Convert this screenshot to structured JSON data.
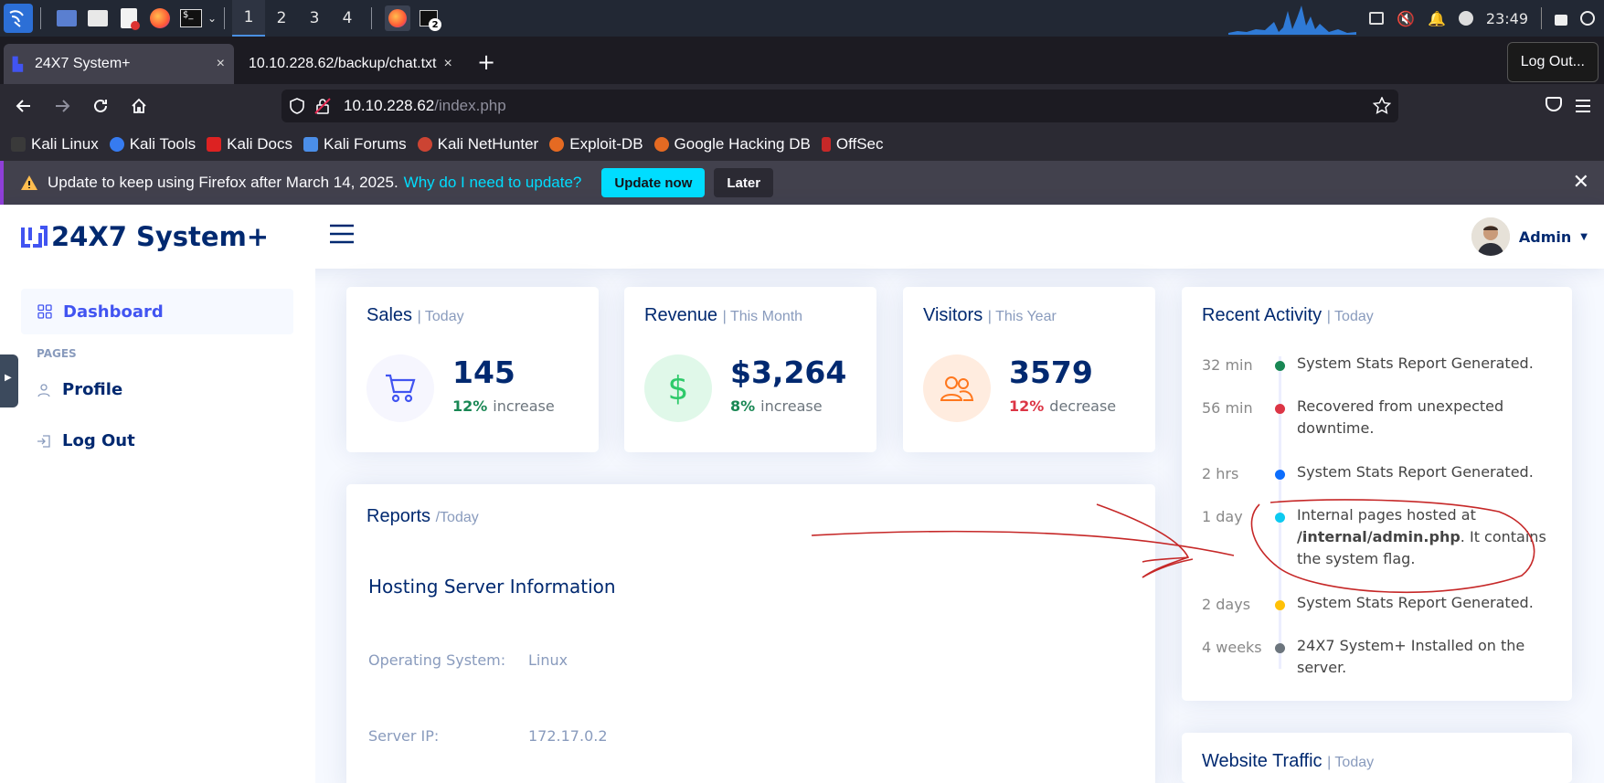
{
  "taskbar": {
    "workspaces": [
      "1",
      "2",
      "3",
      "4"
    ],
    "active_workspace": "1",
    "clock": "23:49",
    "terminal_badge": "2"
  },
  "browser": {
    "tabs": [
      {
        "title": "24X7 System+",
        "close": "×"
      },
      {
        "title": "10.10.228.62/backup/chat.txt",
        "close": "×"
      }
    ],
    "new_tab": "+",
    "tooltip": "Log Out...",
    "url_host": "10.10.228.62",
    "url_path": "/index.php",
    "bookmarks": [
      "Kali Linux",
      "Kali Tools",
      "Kali Docs",
      "Kali Forums",
      "Kali NetHunter",
      "Exploit-DB",
      "Google Hacking DB",
      "OffSec"
    ],
    "notification": {
      "text": "Update to keep using Firefox after March 14, 2025.",
      "link": "Why do I need to update?",
      "update_btn": "Update now",
      "later_btn": "Later",
      "close": "✕"
    }
  },
  "app": {
    "logo": "24X7 System+",
    "user": "Admin",
    "sidebar": {
      "dashboard": "Dashboard",
      "pages_heading": "PAGES",
      "profile": "Profile",
      "logout": "Log Out"
    },
    "cards": {
      "sales": {
        "title": "Sales",
        "sub": "| Today",
        "value": "145",
        "pct": "12%",
        "word": "increase",
        "pct_color": "#198754"
      },
      "revenue": {
        "title": "Revenue",
        "sub": "| This Month",
        "value": "$3,264",
        "pct": "8%",
        "word": "increase",
        "pct_color": "#198754",
        "symbol": "$"
      },
      "visitors": {
        "title": "Visitors",
        "sub": "| This Year",
        "value": "3579",
        "pct": "12%",
        "word": "decrease",
        "pct_color": "#dc3545"
      }
    },
    "reports": {
      "title": "Reports",
      "sub": "/Today",
      "heading": "Hosting Server Information",
      "os_label": "Operating System:",
      "os_value": "Linux",
      "ip_label": "Server IP:",
      "ip_value": "172.17.0.2"
    },
    "activity": {
      "title": "Recent Activity",
      "sub": "| Today",
      "items": [
        {
          "time": "32 min",
          "text": "System Stats Report Generated.",
          "color": "#198754"
        },
        {
          "time": "56 min",
          "text": "Recovered from unexpected downtime.",
          "color": "#dc3545"
        },
        {
          "time": "2 hrs",
          "text": "System Stats Report Generated.",
          "color": "#0d6efd"
        },
        {
          "time": "1 day",
          "text_pre": "Internal pages hosted at ",
          "text_bold": "/internal/admin.php",
          "text_post": ". It contains the system flag.",
          "color": "#0dcaf0"
        },
        {
          "time": "2 days",
          "text": "System Stats Report Generated.",
          "color": "#ffc107"
        },
        {
          "time": "4 weeks",
          "text": "24X7 System+ Installed on the server.",
          "color": "#6c757d"
        }
      ]
    },
    "traffic": {
      "title": "Website Traffic",
      "sub": "| Today"
    }
  }
}
